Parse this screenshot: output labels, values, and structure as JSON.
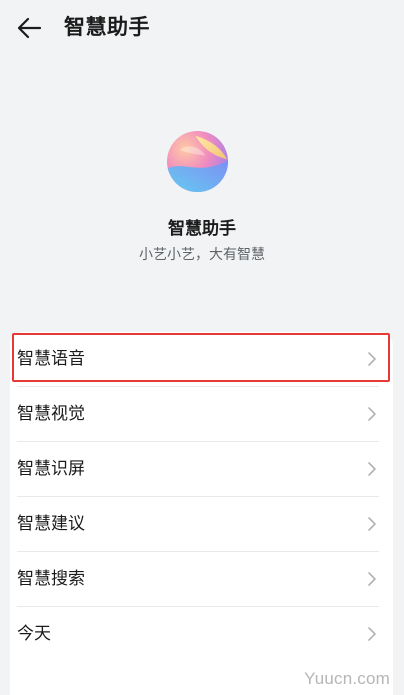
{
  "header": {
    "title": "智慧助手",
    "back_icon": "back-arrow-icon"
  },
  "app": {
    "name": "智慧助手",
    "slogan": "小艺小艺，大有智慧",
    "logo_icon": "celia-orb-logo"
  },
  "menu": {
    "items": [
      {
        "label": "智慧语音",
        "highlighted": true
      },
      {
        "label": "智慧视觉"
      },
      {
        "label": "智慧识屏"
      },
      {
        "label": "智慧建议"
      },
      {
        "label": "智慧搜索"
      },
      {
        "label": "今天"
      }
    ],
    "chevron_icon": "chevron-right-icon"
  },
  "annotation": {
    "highlight_color": "#e53935"
  },
  "watermark": {
    "text": "Yuucn.com"
  },
  "colors": {
    "background": "#f1f3f5",
    "card": "#ffffff",
    "text_primary": "#1b1b1b",
    "text_secondary": "#606366"
  }
}
